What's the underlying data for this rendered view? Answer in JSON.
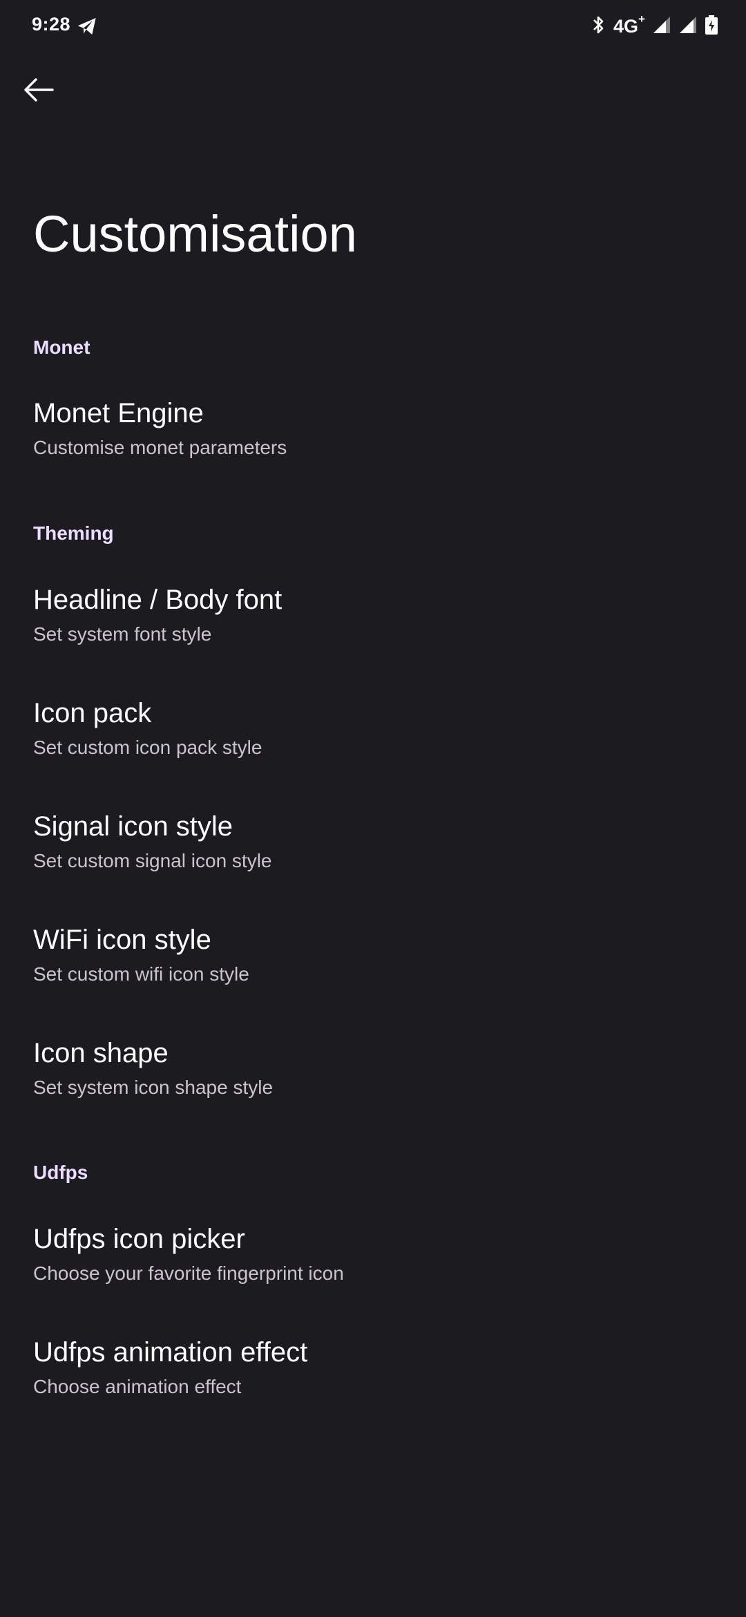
{
  "status_bar": {
    "time": "9:28",
    "network_type": "4G",
    "network_plus": "+"
  },
  "header": {
    "title": "Customisation"
  },
  "sections": [
    {
      "header": "Monet",
      "items": [
        {
          "title": "Monet Engine",
          "summary": "Customise monet parameters"
        }
      ]
    },
    {
      "header": "Theming",
      "items": [
        {
          "title": "Headline / Body font",
          "summary": "Set system font style"
        },
        {
          "title": "Icon pack",
          "summary": "Set custom icon pack style"
        },
        {
          "title": "Signal icon style",
          "summary": "Set custom signal icon style"
        },
        {
          "title": "WiFi icon style",
          "summary": "Set custom wifi icon style"
        },
        {
          "title": "Icon shape",
          "summary": "Set system icon shape style"
        }
      ]
    },
    {
      "header": "Udfps",
      "items": [
        {
          "title": "Udfps icon picker",
          "summary": "Choose your favorite fingerprint icon"
        },
        {
          "title": "Udfps animation effect",
          "summary": "Choose animation effect"
        }
      ]
    }
  ],
  "colors": {
    "background": "#1c1b1f",
    "section_header": "#eaddff",
    "summary": "#cac4d0"
  }
}
